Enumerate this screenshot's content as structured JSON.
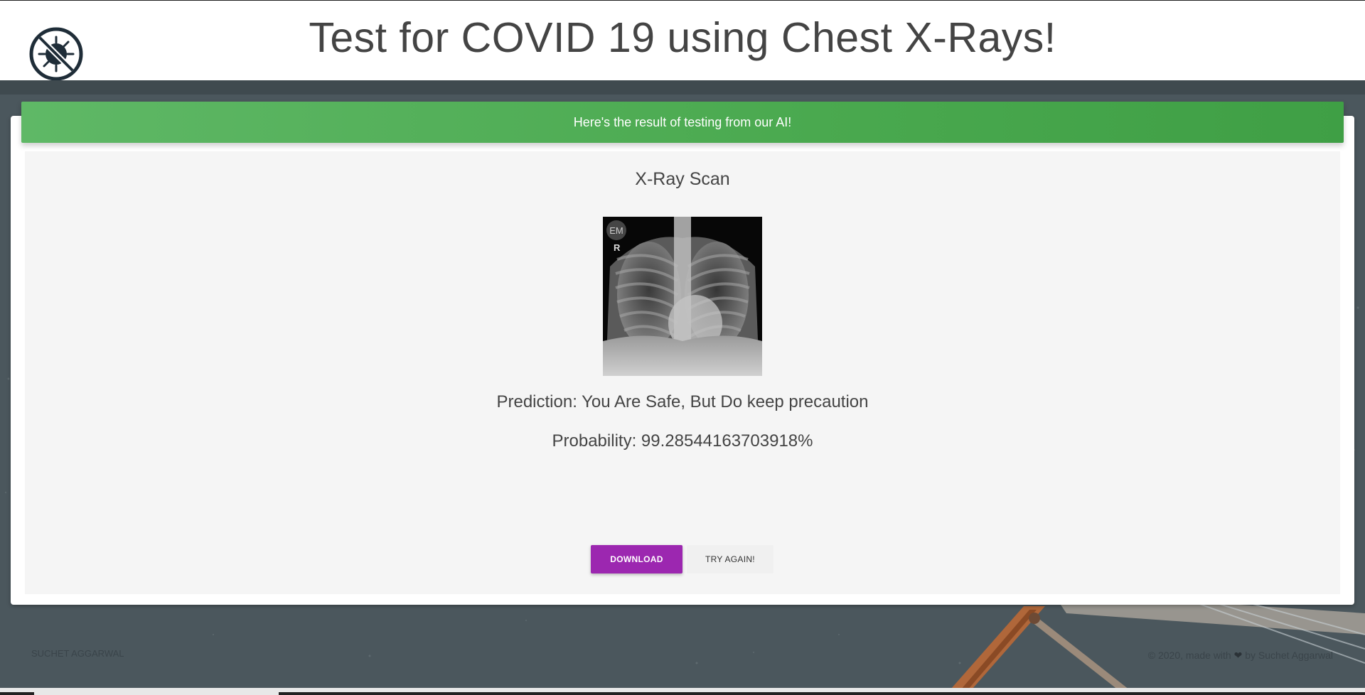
{
  "header": {
    "title": "Test for COVID 19 using Chest X-Rays!",
    "logo_icon": "virus-crossed-icon"
  },
  "alert": {
    "text": "Here's the result of testing from our AI!",
    "color": "#4caf50"
  },
  "result": {
    "scan_title": "X-Ray Scan",
    "image_icon": "chest-xray-image",
    "xray_overlay_text": "EM",
    "xray_side_marker": "R",
    "prediction": "Prediction: You Are Safe, But Do keep precaution",
    "probability": "Probability: 99.28544163703918%"
  },
  "buttons": {
    "download_label": "DOWNLOAD",
    "try_again_label": "TRY AGAIN!",
    "download_color": "#9c27b0"
  },
  "footer": {
    "left_text": "SUCHET AGGARWAL",
    "right_prefix": "© 2020, made with",
    "heart_icon": "heart-icon",
    "right_suffix": "by",
    "author": "Suchet Aggarwal"
  }
}
